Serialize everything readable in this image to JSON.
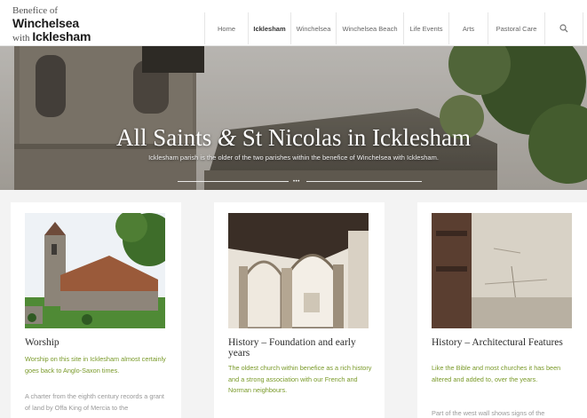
{
  "logo": {
    "line1": "Benefice of",
    "line2": "Winchelsea",
    "line3a": "with ",
    "line3b": "Icklesham"
  },
  "nav": {
    "items": [
      {
        "label": "Home",
        "active": false
      },
      {
        "label": "Icklesham",
        "active": true
      },
      {
        "label": "Winchelsea",
        "active": false
      },
      {
        "label": "Winchelsea Beach",
        "active": false
      },
      {
        "label": "Life Events",
        "active": false
      },
      {
        "label": "Arts",
        "active": false
      },
      {
        "label": "Pastoral Care",
        "active": false
      }
    ],
    "search_icon": "search-icon"
  },
  "hero": {
    "title_a": "All Saints ",
    "title_amp": "&",
    "title_b": " St Nicolas in Icklesham",
    "subtitle": "Icklesham parish is the older of the two parishes within the benefice of Winchelsea with Icklesham.",
    "separator": "•••"
  },
  "cards": [
    {
      "title": "Worship",
      "lead": "Worship on this site in Icklesham almost certainly goes back to Anglo-Saxon times.",
      "body": "A charter from the eighth century records a grant of land by Offa King of Mercia to the"
    },
    {
      "title": "History – Foundation and early years",
      "lead": "The oldest church within benefice as a rich history and a strong association with our French and Norman neighbours.",
      "body": ""
    },
    {
      "title": "History – Architectural Features",
      "lead": "Like the Bible and most churches it has been altered and added to, over the years.",
      "body": "Part of the west wall shows signs of the"
    }
  ],
  "colors": {
    "accent": "#7a9a2a",
    "text": "#2c2c2c",
    "muted": "#999999"
  }
}
